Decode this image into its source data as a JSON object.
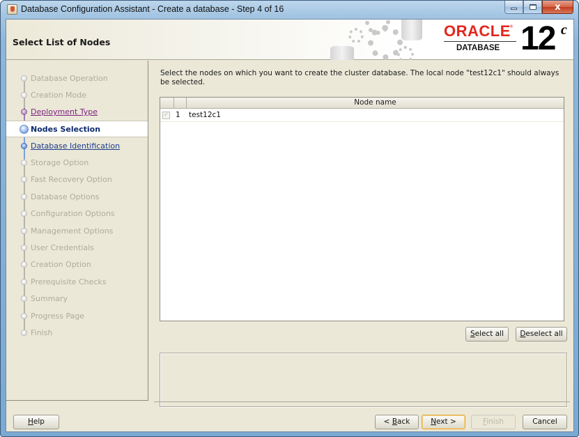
{
  "window": {
    "title": "Database Configuration Assistant - Create a database - Step 4 of 16",
    "caption_buttons": {
      "minimize": "minimize",
      "maximize": "maximize",
      "close": "x"
    }
  },
  "header": {
    "page_title": "Select List of Nodes",
    "logo": {
      "brand": "ORACLE",
      "registered": "®",
      "product": "DATABASE",
      "version": "12",
      "version_suffix": "c"
    }
  },
  "colors": {
    "accent_brand": "#e3261c",
    "visited_step": "#7b1f7e",
    "next_step": "#1d3b8a",
    "disabled_step": "#aeab9e",
    "background": "#ebe8d8"
  },
  "sidebar": {
    "steps": [
      {
        "label": "Database Operation",
        "state": "done"
      },
      {
        "label": "Creation Mode",
        "state": "done"
      },
      {
        "label": "Deployment Type",
        "state": "visited"
      },
      {
        "label": "Nodes Selection",
        "state": "current"
      },
      {
        "label": "Database Identification",
        "state": "next"
      },
      {
        "label": "Storage Option",
        "state": "disabled"
      },
      {
        "label": "Fast Recovery Option",
        "state": "disabled"
      },
      {
        "label": "Database Options",
        "state": "disabled"
      },
      {
        "label": "Configuration Options",
        "state": "disabled"
      },
      {
        "label": "Management Options",
        "state": "disabled"
      },
      {
        "label": "User Credentials",
        "state": "disabled"
      },
      {
        "label": "Creation Option",
        "state": "disabled"
      },
      {
        "label": "Prerequisite Checks",
        "state": "disabled"
      },
      {
        "label": "Summary",
        "state": "disabled"
      },
      {
        "label": "Progress Page",
        "state": "disabled"
      },
      {
        "label": "Finish",
        "state": "disabled"
      }
    ]
  },
  "main": {
    "instructions": "Select the nodes on which you want to create the cluster database. The local node \"test12c1\" should always be selected.",
    "table": {
      "columns": [
        "",
        "",
        "Node name"
      ],
      "rows": [
        {
          "checked": true,
          "checkbox_enabled": false,
          "index": "1",
          "node_name": "test12c1"
        }
      ]
    },
    "select_all": {
      "label": "Select all",
      "mnemonic": "S",
      "rest": "elect all"
    },
    "deselect_all": {
      "label": "Deselect all",
      "mnemonic": "D",
      "rest": "eselect all"
    },
    "message": ""
  },
  "footer": {
    "help": {
      "label": "Help",
      "mnemonic": "H",
      "rest": "elp"
    },
    "back": {
      "label": "< Back",
      "prefix": "< ",
      "mnemonic": "B",
      "rest": "ack"
    },
    "next": {
      "label": "Next >",
      "mnemonic": "N",
      "rest": "ext >"
    },
    "finish": {
      "label": "Finish",
      "mnemonic": "F",
      "rest": "inish",
      "enabled": false
    },
    "cancel": {
      "label": "Cancel"
    }
  }
}
